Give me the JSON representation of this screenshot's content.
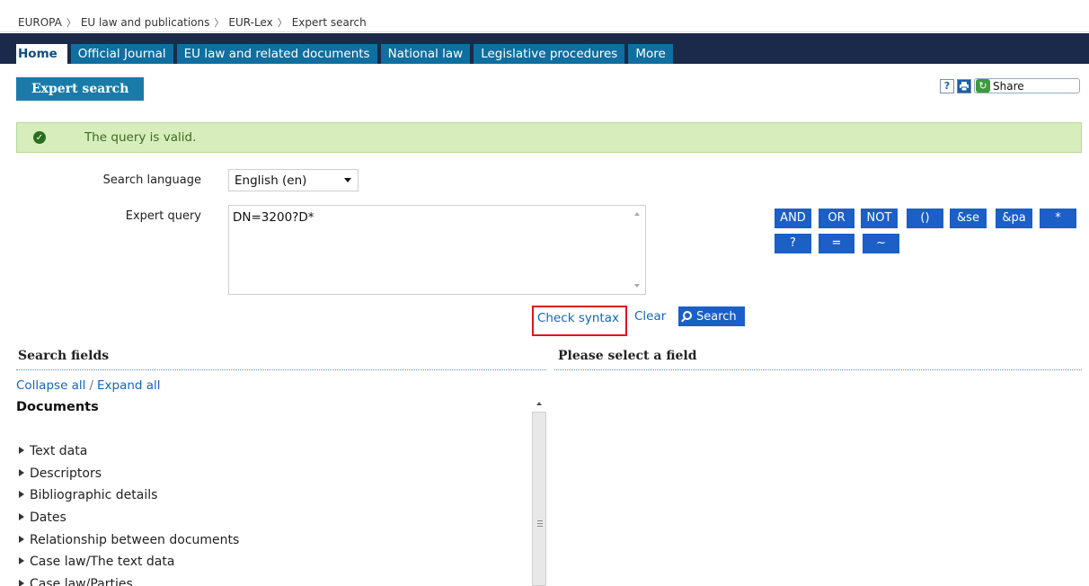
{
  "breadcrumb": {
    "items": [
      "EUROPA",
      "EU law and publications",
      "EUR-Lex",
      "Expert search"
    ]
  },
  "nav": {
    "tabs": [
      "Home",
      "Official Journal",
      "EU law and related documents",
      "National law",
      "Legislative procedures",
      "More"
    ]
  },
  "page": {
    "title": "Expert search",
    "help_icon": "?",
    "share_label": "Share"
  },
  "message": {
    "text": "The query is valid.",
    "type": "success"
  },
  "form": {
    "language_label": "Search language",
    "language_value": "English (en)",
    "query_label": "Expert query",
    "query_value": "DN=3200?D*",
    "operators": [
      "AND",
      "OR",
      "NOT",
      "()",
      "&se",
      "&pa",
      "*",
      "?",
      "=",
      "~"
    ],
    "check_syntax_label": "Check syntax",
    "clear_label": "Clear",
    "search_label": "Search"
  },
  "search_fields": {
    "heading": "Search fields",
    "collapse_all": "Collapse all",
    "separator": "/",
    "expand_all": "Expand all",
    "group": "Documents",
    "items": [
      "Text data",
      "Descriptors",
      "Bibliographic details",
      "Dates",
      "Relationship between documents",
      "Case law/The text data",
      "Case law/Parties"
    ]
  },
  "field_panel": {
    "heading": "Please select a field"
  },
  "colors": {
    "nav_bg": "#1b2a4a",
    "tab_bg": "#0e6fa0",
    "title_bg": "#1a7ba8",
    "operator_bg": "#1b5fc7",
    "success_bg": "#d7eebc",
    "link": "#1565c0",
    "highlight_border": "#e0131c"
  }
}
